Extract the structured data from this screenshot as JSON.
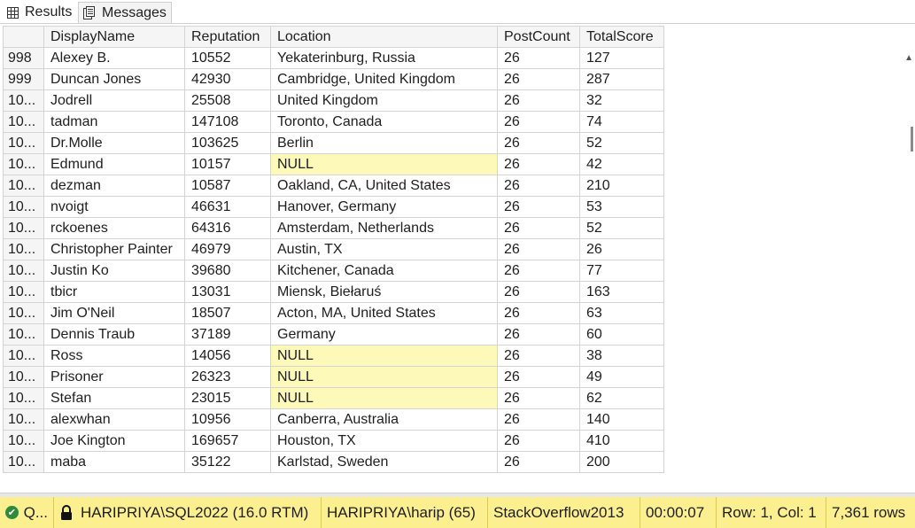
{
  "tabs": [
    {
      "label": "Results",
      "icon": "grid-icon"
    },
    {
      "label": "Messages",
      "icon": "messages-icon"
    }
  ],
  "grid": {
    "columns": [
      "DisplayName",
      "Reputation",
      "Location",
      "PostCount",
      "TotalScore"
    ],
    "rows": [
      {
        "num": "998",
        "cells": [
          "Alexey B.",
          "10552",
          "Yekaterinburg, Russia",
          "26",
          "127"
        ]
      },
      {
        "num": "999",
        "cells": [
          "Duncan Jones",
          "42930",
          "Cambridge, United Kingdom",
          "26",
          "287"
        ]
      },
      {
        "num": "10...",
        "cells": [
          "Jodrell",
          "25508",
          "United Kingdom",
          "26",
          "32"
        ]
      },
      {
        "num": "10...",
        "cells": [
          "tadman",
          "147108",
          "Toronto, Canada",
          "26",
          "74"
        ]
      },
      {
        "num": "10...",
        "cells": [
          "Dr.Molle",
          "103625",
          "Berlin",
          "26",
          "52"
        ]
      },
      {
        "num": "10...",
        "cells": [
          "Edmund",
          "10157",
          "NULL",
          "26",
          "42"
        ]
      },
      {
        "num": "10...",
        "cells": [
          "dezman",
          "10587",
          "Oakland, CA, United States",
          "26",
          "210"
        ]
      },
      {
        "num": "10...",
        "cells": [
          "nvoigt",
          "46631",
          "Hanover, Germany",
          "26",
          "53"
        ]
      },
      {
        "num": "10...",
        "cells": [
          "rckoenes",
          "64316",
          "Amsterdam, Netherlands",
          "26",
          "52"
        ]
      },
      {
        "num": "10...",
        "cells": [
          "Christopher Painter",
          "46979",
          "Austin, TX",
          "26",
          "26"
        ]
      },
      {
        "num": "10...",
        "cells": [
          "Justin Ko",
          "39680",
          "Kitchener, Canada",
          "26",
          "77"
        ]
      },
      {
        "num": "10...",
        "cells": [
          "tbicr",
          "13031",
          "Miensk, Biełaruś",
          "26",
          "163"
        ]
      },
      {
        "num": "10...",
        "cells": [
          "Jim O'Neil",
          "18507",
          "Acton, MA, United States",
          "26",
          "63"
        ]
      },
      {
        "num": "10...",
        "cells": [
          "Dennis Traub",
          "37189",
          "Germany",
          "26",
          "60"
        ]
      },
      {
        "num": "10...",
        "cells": [
          "Ross",
          "14056",
          "NULL",
          "26",
          "38"
        ]
      },
      {
        "num": "10...",
        "cells": [
          "Prisoner",
          "26323",
          "NULL",
          "26",
          "49"
        ]
      },
      {
        "num": "10...",
        "cells": [
          "Stefan",
          "23015",
          "NULL",
          "26",
          "62"
        ]
      },
      {
        "num": "10...",
        "cells": [
          "alexwhan",
          "10956",
          "Canberra, Australia",
          "26",
          "140"
        ]
      },
      {
        "num": "10...",
        "cells": [
          "Joe Kington",
          "169657",
          "Houston, TX",
          "26",
          "410"
        ]
      },
      {
        "num": "10...",
        "cells": [
          "maba",
          "35122",
          "Karlstad, Sweden",
          "26",
          "200"
        ]
      }
    ]
  },
  "status": {
    "query_state": "Q...",
    "server": "HARIPRIYA\\SQL2022 (16.0 RTM)",
    "user": "HARIPRIYA\\harip (65)",
    "database": "StackOverflow2013",
    "elapsed": "00:00:07",
    "position": "Row: 1, Col: 1",
    "rows": "7,361 rows"
  },
  "colors": {
    "status_bar": "#fcef8f",
    "null_highlight": "#fdf9b8",
    "success": "#2f8a3b"
  }
}
